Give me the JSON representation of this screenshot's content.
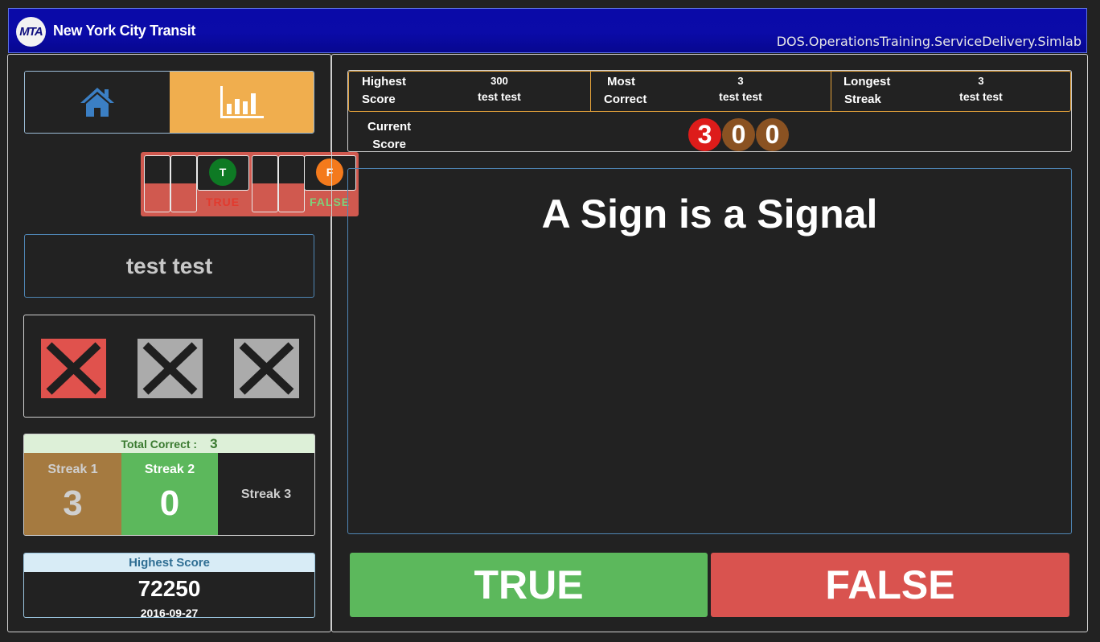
{
  "header": {
    "logo_text": "MTA",
    "brand": "New York City Transit",
    "app_name": "DOS.OperationsTraining.ServiceDelivery.Simlab"
  },
  "nav": {
    "home_icon": "home-icon",
    "stats_icon": "bar-chart-icon"
  },
  "widget": {
    "true_letter": "T",
    "false_letter": "F",
    "true_label": "TRUE",
    "false_label": "FALSE"
  },
  "user": {
    "name": "test test"
  },
  "strikes": {
    "count": 3,
    "used": 1,
    "icon": "x-mark-icon"
  },
  "totals": {
    "label": "Total Correct  :",
    "value": "3",
    "streaks": [
      {
        "label": "Streak 1",
        "value": "3"
      },
      {
        "label": "Streak 2",
        "value": "0"
      },
      {
        "label": "Streak 3",
        "value": ""
      }
    ]
  },
  "highest": {
    "label": "Highest Score",
    "value": "72250",
    "date": "2016-09-27"
  },
  "leaderboard": {
    "cells": [
      {
        "line1": "Highest",
        "line2": "Score",
        "value": "300",
        "holder": "test test"
      },
      {
        "line1": "Most",
        "line2": "Correct",
        "value": "3",
        "holder": "test test"
      },
      {
        "line1": "Longest",
        "line2": "Streak",
        "value": "3",
        "holder": "test test"
      }
    ],
    "current_label_1": "Current",
    "current_label_2": "Score",
    "current_digits": [
      "3",
      "0",
      "0"
    ]
  },
  "question": {
    "text": "A Sign is a Signal"
  },
  "answers": {
    "true_label": "TRUE",
    "false_label": "FALSE"
  },
  "colors": {
    "header_blue": "#0a0aa8",
    "accent_orange": "#f0ae4e",
    "true_green": "#5cb85c",
    "false_red": "#d9534f",
    "digit_red": "#dd1c1a",
    "digit_brown": "#8a5222",
    "streak1_bg": "#a57a40",
    "streak2_bg": "#5cb85c"
  }
}
